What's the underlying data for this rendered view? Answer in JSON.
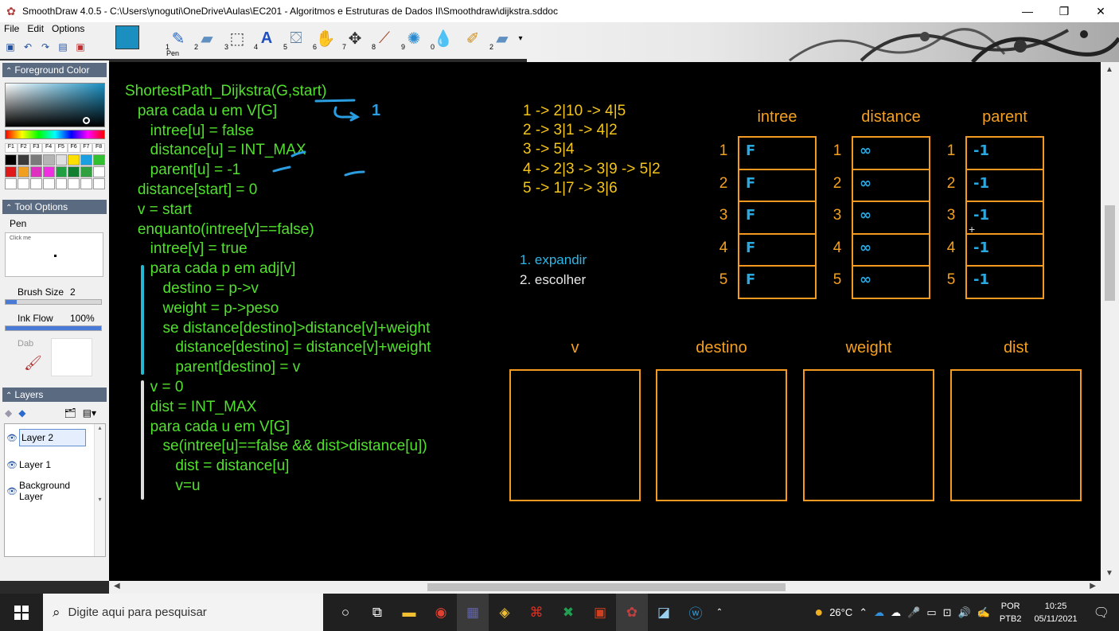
{
  "window": {
    "title": "SmoothDraw 4.0.5 - C:\\Users\\ynoguti\\OneDrive\\Aulas\\EC201 - Algoritmos e Estruturas de Dados II\\Smoothdraw\\dijkstra.sddoc",
    "minimize": "—",
    "maximize": "❐",
    "close": "✕"
  },
  "menu": [
    "File",
    "Edit",
    "Options"
  ],
  "toolbar": {
    "pen_label": "Pen",
    "tool_numbers": [
      "1",
      "2",
      "3",
      "4",
      "5",
      "6",
      "7",
      "8",
      "9",
      "0",
      "2"
    ],
    "foreground_color": "#1a8fc0"
  },
  "sidebar": {
    "foreground_title": "Foreground Color",
    "fkeys": [
      "F1",
      "F2",
      "F3",
      "F4",
      "F5",
      "F6",
      "F7",
      "F8"
    ],
    "swatches": [
      "#000000",
      "#3a3a3a",
      "#7a7a7a",
      "#b4b4b4",
      "#e0e0e0",
      "#ffe000",
      "#1aa0e0",
      "#30c030",
      "#e01a1a",
      "#f0a020",
      "#e030c0",
      "#f030e0",
      "#20a040",
      "#108030",
      "#30a040",
      "#ffffff",
      "#ffffff",
      "#ffffff",
      "#ffffff",
      "#ffffff",
      "#ffffff",
      "#ffffff",
      "#ffffff",
      "#ffffff"
    ],
    "tool_options_title": "Tool Options",
    "tool_name": "Pen",
    "click_me": "Click me",
    "brush_size_label": "Brush Size",
    "brush_size_value": "2",
    "ink_flow_label": "Ink Flow",
    "ink_flow_value": "100%",
    "dab_label": "Dab",
    "layers_title": "Layers",
    "layers": [
      "Layer 2",
      "Layer 1",
      "Background\nLayer"
    ]
  },
  "canvas": {
    "code": [
      "ShortestPath_Dijkstra(G,start)",
      "   para cada u em V[G]",
      "      intree[u] = false",
      "      distance[u] = INT_MAX",
      "      parent[u] = -1",
      "   distance[start] = 0",
      "   v = start",
      "   enquanto(intree[v]==false)",
      "      intree[v] = true",
      "      para cada p em adj[v]",
      "         destino = p->v",
      "         weight = p->peso",
      "         se distance[destino]>distance[v]+weight",
      "            distance[destino] = distance[v]+weight",
      "            parent[destino] = v",
      "      v = 0",
      "      dist = INT_MAX",
      "      para cada u em V[G]",
      "         se(intree[u]==false && dist>distance[u])",
      "            dist = distance[u]",
      "            v=u"
    ],
    "adjacency": [
      "1 -> 2|10 -> 4|5",
      "2 -> 3|1 -> 4|2",
      "3 -> 5|4",
      "4 -> 2|3 -> 3|9 -> 5|2",
      "5 -> 1|7 -> 3|6"
    ],
    "steps": [
      "1. expandir",
      "2. escolher"
    ],
    "annotation_one": "1",
    "tables": [
      {
        "header": "intree",
        "values": [
          "F",
          "F",
          "F",
          "F",
          "F"
        ]
      },
      {
        "header": "distance",
        "values": [
          "∞",
          "∞",
          "∞",
          "∞",
          "∞"
        ]
      },
      {
        "header": "parent",
        "values": [
          "-1",
          "-1",
          "-1",
          "-1",
          "-1"
        ]
      }
    ],
    "row_numbers": [
      "1",
      "2",
      "3",
      "4",
      "5"
    ],
    "variable_boxes": [
      "v",
      "destino",
      "weight",
      "dist"
    ]
  },
  "taskbar": {
    "search_placeholder": "Digite aqui para pesquisar",
    "weather": "26°C",
    "language_top": "POR",
    "language_bottom": "PTB2",
    "time": "10:25",
    "date": "05/11/2021"
  }
}
